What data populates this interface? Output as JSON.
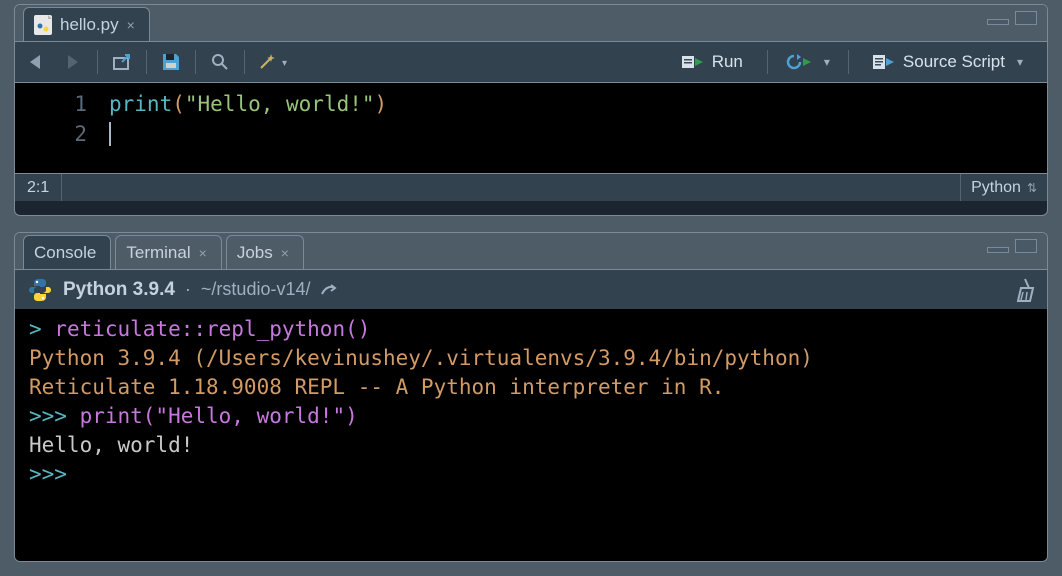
{
  "editor": {
    "tab": {
      "filename": "hello.py"
    },
    "toolbar": {
      "run_label": "Run",
      "source_label": "Source Script"
    },
    "lines": [
      {
        "n": "1",
        "fn": "print",
        "open": "(",
        "str": "\"Hello, world!\"",
        "close": ")"
      },
      {
        "n": "2"
      }
    ],
    "status": {
      "pos": "2:1",
      "lang": "Python"
    }
  },
  "console": {
    "tabs": {
      "console": "Console",
      "terminal": "Terminal",
      "jobs": "Jobs"
    },
    "header": {
      "version": "Python 3.9.4",
      "sep": " · ",
      "path": "~/rstudio-v14/"
    },
    "lines": {
      "l1_prompt": "> ",
      "l1_cmd": "reticulate::repl_python()",
      "l2": "Python 3.9.4 (/Users/kevinushey/.virtualenvs/3.9.4/bin/python)",
      "l3": "Reticulate 1.18.9008 REPL -- A Python interpreter in R.",
      "l4_prompt": ">>> ",
      "l4_cmd": "print(\"Hello, world!\")",
      "l5": "Hello, world!",
      "l6_prompt": ">>> "
    }
  }
}
